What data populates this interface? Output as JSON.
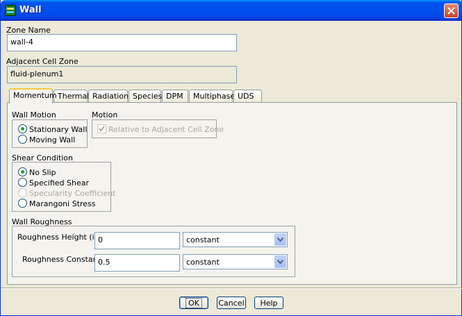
{
  "window": {
    "title": "Wall"
  },
  "zone_name": {
    "label": "Zone Name",
    "value": "wall-4"
  },
  "adjacent_cell_zone": {
    "label": "Adjacent Cell Zone",
    "value": "fluid-plenum1"
  },
  "tabs": [
    {
      "label": "Momentum",
      "active": true
    },
    {
      "label": "Thermal"
    },
    {
      "label": "Radiation"
    },
    {
      "label": "Species"
    },
    {
      "label": "DPM"
    },
    {
      "label": "Multiphase"
    },
    {
      "label": "UDS"
    }
  ],
  "wall_motion": {
    "label": "Wall Motion",
    "options": [
      {
        "label": "Stationary Wall",
        "selected": true
      },
      {
        "label": "Moving Wall",
        "selected": false
      }
    ]
  },
  "motion": {
    "label": "Motion",
    "relative_checkbox": {
      "label": "Relative to Adjacent Cell Zone",
      "checked": true,
      "disabled": true
    }
  },
  "shear_condition": {
    "label": "Shear Condition",
    "options": [
      {
        "label": "No Slip",
        "selected": true
      },
      {
        "label": "Specified Shear",
        "selected": false
      },
      {
        "label": "Specularity Coefficient",
        "selected": false,
        "disabled": true
      },
      {
        "label": "Marangoni Stress",
        "selected": false
      }
    ]
  },
  "wall_roughness": {
    "label": "Wall Roughness",
    "height": {
      "label": "Roughness Height (in)",
      "value": "0",
      "method": "constant"
    },
    "constant": {
      "label": "Roughness Constant",
      "value": "0.5",
      "method": "constant"
    }
  },
  "buttons": {
    "ok": "OK",
    "cancel": "Cancel",
    "help": "Help"
  }
}
